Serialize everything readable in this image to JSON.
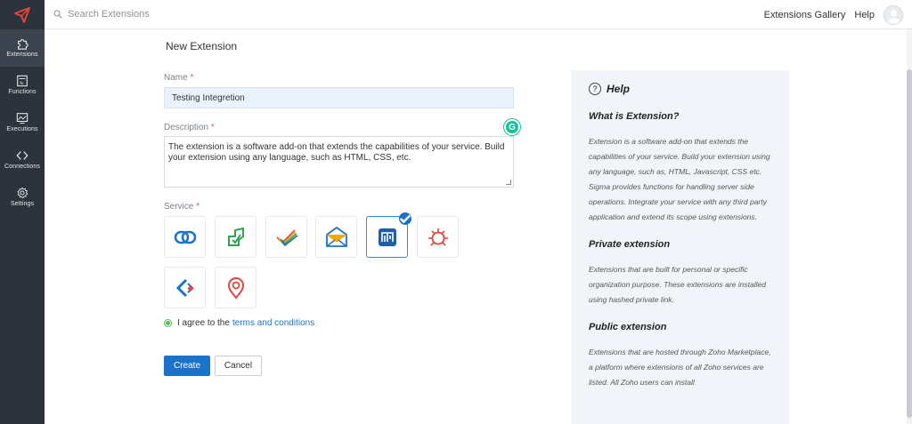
{
  "sidebar": {
    "items": [
      {
        "label": "Extensions",
        "icon": "puzzle-icon"
      },
      {
        "label": "Functions",
        "icon": "function-icon"
      },
      {
        "label": "Executions",
        "icon": "monitor-icon"
      },
      {
        "label": "Connections",
        "icon": "connection-icon"
      },
      {
        "label": "Settings",
        "icon": "gear-icon"
      }
    ]
  },
  "topbar": {
    "search_placeholder": "Search Extensions",
    "gallery": "Extensions Gallery",
    "help": "Help"
  },
  "form": {
    "title": "New Extension",
    "name_label": "Name",
    "name_value": "Testing Integretion",
    "desc_label": "Description",
    "desc_value": "The extension is a software add-on that extends the capabilities of your service. Build your extension using any language, such as HTML, CSS, etc.",
    "service_label": "Service",
    "required_mark": "*",
    "services": [
      {
        "icon": "zoho-link-icon",
        "selected": false
      },
      {
        "icon": "zoho-creator-icon",
        "selected": false
      },
      {
        "icon": "zoho-checkmark-icon",
        "selected": false
      },
      {
        "icon": "zoho-mail-icon",
        "selected": false
      },
      {
        "icon": "zoho-projects-icon",
        "selected": true
      },
      {
        "icon": "bug-tracker-icon",
        "selected": false
      },
      {
        "icon": "zoho-sprints-icon",
        "selected": false
      },
      {
        "icon": "location-pin-icon",
        "selected": false
      }
    ],
    "agree_text": "I agree to the",
    "terms_link": "terms and conditions",
    "create_label": "Create",
    "cancel_label": "Cancel"
  },
  "help": {
    "title": "Help",
    "sections": [
      {
        "heading": "What is Extension?",
        "body": "Extension is a software add-on that extends the capabilities of your service. Build your extension using any language, such as, HTML, Javascript, CSS etc. Sigma provides functions for handling server side operations. Integrate your service with any third party application and extend its scope using extensions."
      },
      {
        "heading": "Private extension",
        "body": "Extensions that are built for personal or specific organization purpose. These extensions are installed using hashed private link."
      },
      {
        "heading": "Public extension",
        "body": "Extensions that are hosted through Zoho Marketplace, a platform where extensions of all Zoho services are listed. All Zoho users can install"
      }
    ]
  },
  "colors": {
    "sidebar_bg": "#2c333d",
    "primary": "#1a73c8",
    "help_bg": "#f1f5fa",
    "required": "#e55555"
  }
}
